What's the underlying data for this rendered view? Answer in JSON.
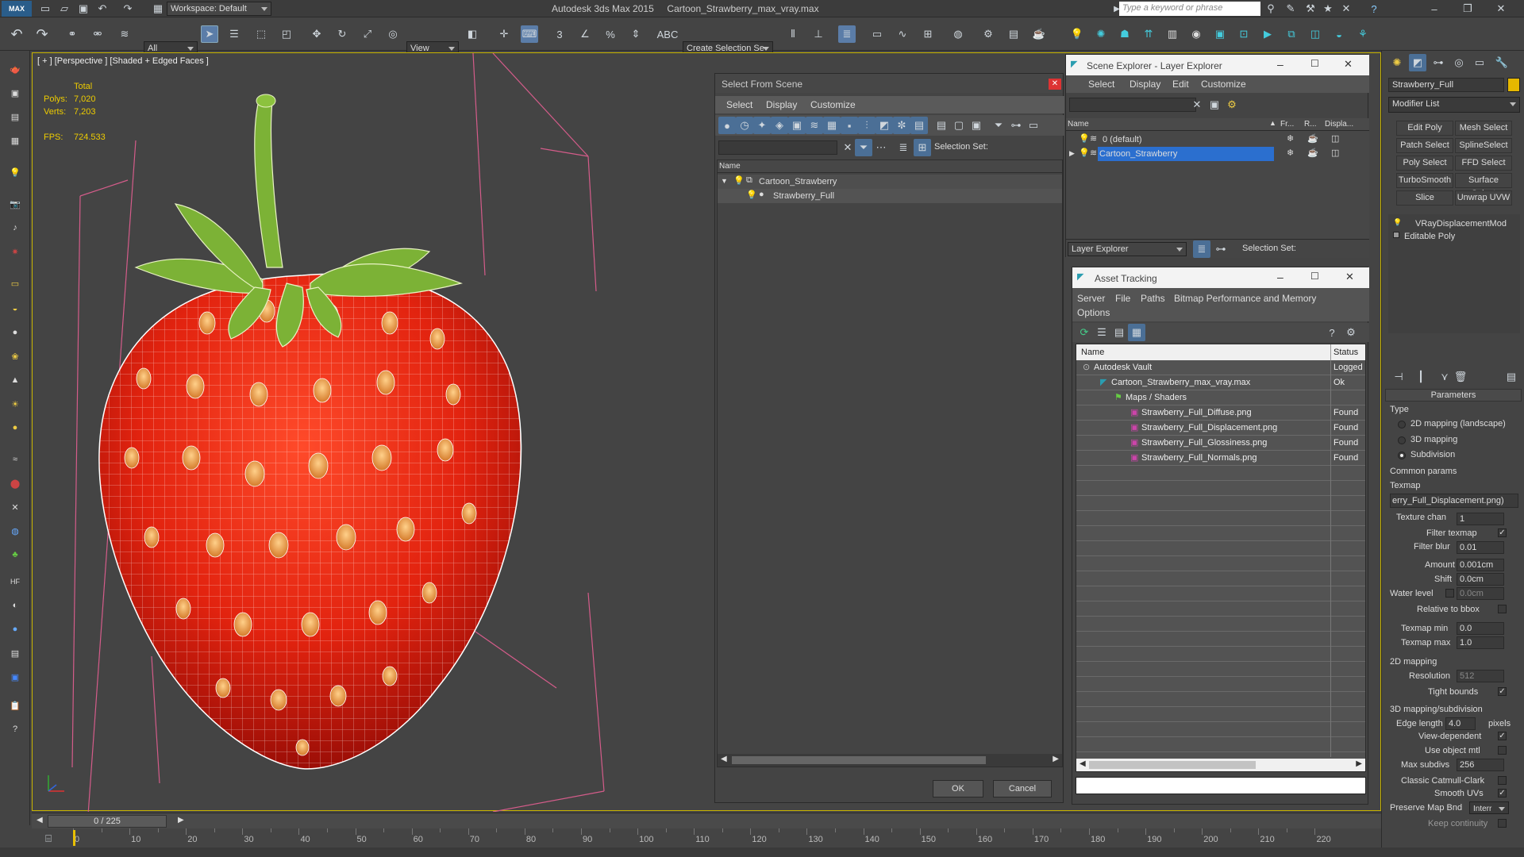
{
  "app": {
    "logo": "MAX",
    "workspace": "Workspace: Default",
    "title": "Autodesk 3ds Max  2015",
    "file": "Cartoon_Strawberry_max_vray.max",
    "search_placeholder": "Type a keyword or phrase"
  },
  "toolbar": {
    "filter": "All",
    "ref_coord": "View",
    "selection_set": "Create Selection Se"
  },
  "viewport": {
    "label": "[ + ] [Perspective ] [Shaded + Edged Faces ]",
    "stats_total": "Total",
    "polys_label": "Polys:",
    "polys": "7,020",
    "verts_label": "Verts:",
    "verts": "7,203",
    "fps_label": "FPS:",
    "fps": "724.533"
  },
  "select_dialog": {
    "title": "Select From Scene",
    "menu": [
      "Select",
      "Display",
      "Customize"
    ],
    "selection_set_label": "Selection Set:",
    "column_name": "Name",
    "items": [
      {
        "name": "Cartoon_Strawberry"
      },
      {
        "name": "Strawberry_Full"
      }
    ],
    "ok": "OK",
    "cancel": "Cancel"
  },
  "scene_explorer": {
    "title": "Scene Explorer - Layer Explorer",
    "menu": [
      "Select",
      "Display",
      "Edit",
      "Customize"
    ],
    "columns": [
      "Name",
      "Fr...",
      "R...",
      "Displa..."
    ],
    "rows": [
      {
        "name": "0 (default)"
      },
      {
        "name": "Cartoon_Strawberry"
      }
    ],
    "footer_dropdown": "Layer Explorer",
    "selection_set_label": "Selection Set:"
  },
  "asset_tracking": {
    "title": "Asset Tracking",
    "menu": [
      "Server",
      "File",
      "Paths",
      "Bitmap Performance and Memory",
      "Options"
    ],
    "columns": [
      "Name",
      "Status"
    ],
    "rows": [
      {
        "name": "Autodesk Vault",
        "status": "Logged"
      },
      {
        "name": "Cartoon_Strawberry_max_vray.max",
        "status": "Ok"
      },
      {
        "name": "Maps / Shaders",
        "status": ""
      },
      {
        "name": "Strawberry_Full_Diffuse.png",
        "status": "Found"
      },
      {
        "name": "Strawberry_Full_Displacement.png",
        "status": "Found"
      },
      {
        "name": "Strawberry_Full_Glossiness.png",
        "status": "Found"
      },
      {
        "name": "Strawberry_Full_Normals.png",
        "status": "Found"
      }
    ]
  },
  "command_panel": {
    "object_name": "Strawberry_Full",
    "modifier_list": "Modifier List",
    "buttons": [
      "Edit Poly",
      "Mesh Select",
      "Patch Select",
      "SplineSelect",
      "Poly Select",
      "FFD Select",
      "TurboSmooth",
      "Surface Select",
      "Slice",
      "Unwrap UVW"
    ],
    "stack": [
      "VRayDisplacementMod",
      "Editable Poly"
    ],
    "params": {
      "rollout": "Parameters",
      "type_label": "Type",
      "type_options": [
        "2D mapping (landscape)",
        "3D mapping",
        "Subdivision"
      ],
      "type_selected": 2,
      "common_label": "Common params",
      "texmap_label": "Texmap",
      "texmap_value": "erry_Full_Displacement.png)",
      "texture_chan_label": "Texture chan",
      "texture_chan": "1",
      "filter_texmap_label": "Filter texmap",
      "filter_blur_label": "Filter blur",
      "filter_blur": "0.01",
      "amount_label": "Amount",
      "amount": "0.001cm",
      "shift_label": "Shift",
      "shift": "0.0cm",
      "water_label": "Water level",
      "water": "0.0cm",
      "relative_label": "Relative to bbox",
      "texmap_min_label": "Texmap min",
      "texmap_min": "0.0",
      "texmap_max_label": "Texmap max",
      "texmap_max": "1.0",
      "mapping2d_label": "2D mapping",
      "resolution_label": "Resolution",
      "resolution": "512",
      "tight_label": "Tight bounds",
      "mapping3d_label": "3D mapping/subdivision",
      "edge_label": "Edge length",
      "edge": "4.0",
      "pixels_label": "pixels",
      "view_dep_label": "View-dependent",
      "use_obj_label": "Use object mtl",
      "max_subdivs_label": "Max subdivs",
      "max_subdivs": "256",
      "catmull_label": "Classic Catmull-Clark",
      "smooth_uv_label": "Smooth UVs",
      "preserve_label": "Preserve Map Bnd",
      "preserve": "Interr",
      "keep_label": "Keep continuity"
    }
  },
  "timeline": {
    "frame": "0 / 225",
    "ticks": [
      "0",
      "10",
      "20",
      "30",
      "40",
      "50",
      "60",
      "70",
      "80",
      "90",
      "100",
      "110",
      "120",
      "130",
      "140",
      "150",
      "160",
      "170",
      "180",
      "190",
      "200",
      "210",
      "220"
    ]
  }
}
